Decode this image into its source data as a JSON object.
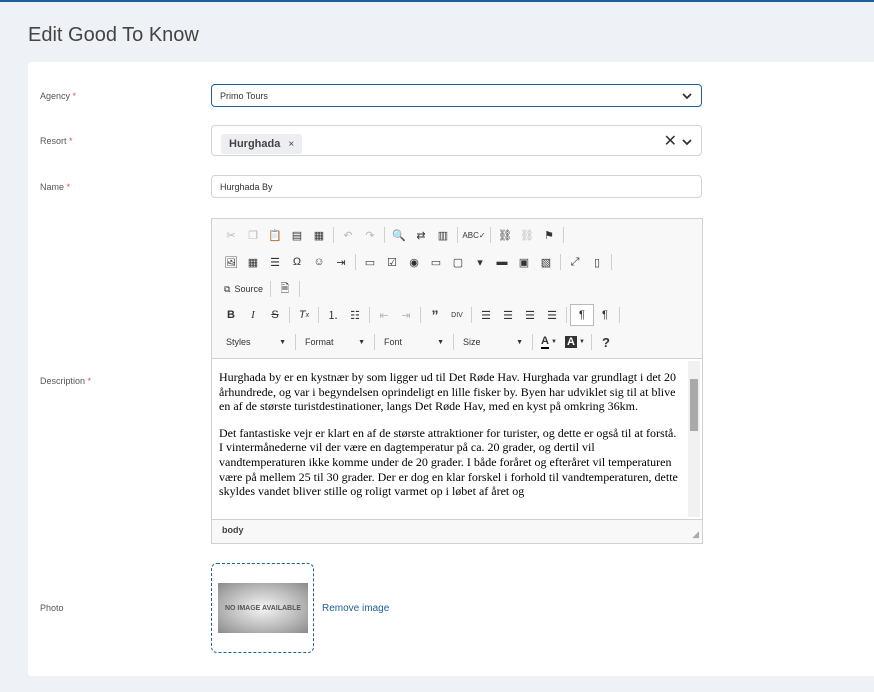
{
  "page": {
    "title": "Edit Good To Know"
  },
  "form": {
    "agency": {
      "label": "Agency",
      "required": "*",
      "value": "Primo Tours"
    },
    "resort": {
      "label": "Resort",
      "required": "*",
      "tag": "Hurghada",
      "tag_remove": "×",
      "clear": "✕"
    },
    "name": {
      "label": "Name",
      "required": "*",
      "value": "Hurghada By"
    },
    "description": {
      "label": "Description",
      "required": "*",
      "paragraphs": [
        "Hurghada by er en kystnær by som ligger ud til Det Røde Hav. Hurghada var grundlagt i det 20 århundrede, og var i begyndelsen oprindeligt en lille fisker by. Byen har udviklet sig til at blive en af de største turistdestinationer, langs Det Røde Hav, med en kyst på omkring 36km.",
        "Det fantastiske vejr er klart en af de største attraktioner for turister, og dette er også til at forstå. I vintermånederne vil der være en dagtemperatur på ca. 20 grader, og dertil vil vandtemperaturen ikke komme under de 20 grader. I både foråret og efteråret vil temperaturen være på mellem 25 til 30 grader. Der er dog en klar forskel i forhold til vandtemperaturen, dette skyldes vandet bliver stille og roligt varmet op i løbet af året og"
      ],
      "path": "body"
    },
    "photo": {
      "label": "Photo",
      "placeholder_text": "NO IMAGE AVAILABLE",
      "remove_link": "Remove image"
    }
  },
  "toolbar": {
    "source_label": "Source",
    "styles": "Styles",
    "format": "Format",
    "font": "Font",
    "size": "Size",
    "help": "?"
  },
  "colors": {
    "accent": "#1e5f99",
    "required": "#d9534f"
  }
}
